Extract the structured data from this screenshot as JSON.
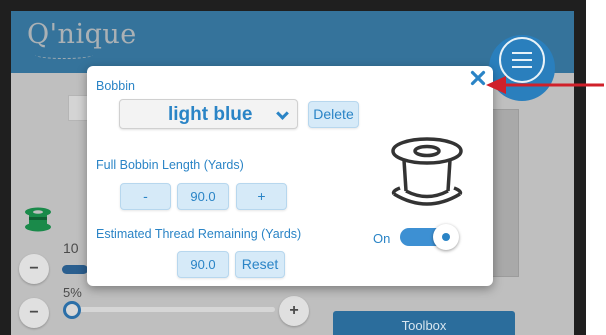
{
  "app": {
    "logo_text": "Q'nique",
    "brand_color": "#2b8fcf"
  },
  "background": {
    "progress_label": "10",
    "progress_value_percent": 10,
    "speed_label": "5%",
    "speed_value_percent": 5,
    "minus_symbol": "−",
    "plus_symbol": "+",
    "toolbox_label": "Toolbox"
  },
  "modal": {
    "bobbin_label": "Bobbin",
    "bobbin_selected": "light blue",
    "delete_label": "Delete",
    "full_length_label": "Full Bobbin Length (Yards)",
    "minus_label": "-",
    "full_length_value": "90.0",
    "plus_label": "+",
    "remaining_label": "Estimated Thread Remaining (Yards)",
    "remaining_value": "90.0",
    "reset_label": "Reset",
    "toggle_label": "On",
    "toggle_state": true,
    "accent_color": "#2a84c6"
  },
  "annotation": {
    "arrow_color": "#d0202a"
  }
}
